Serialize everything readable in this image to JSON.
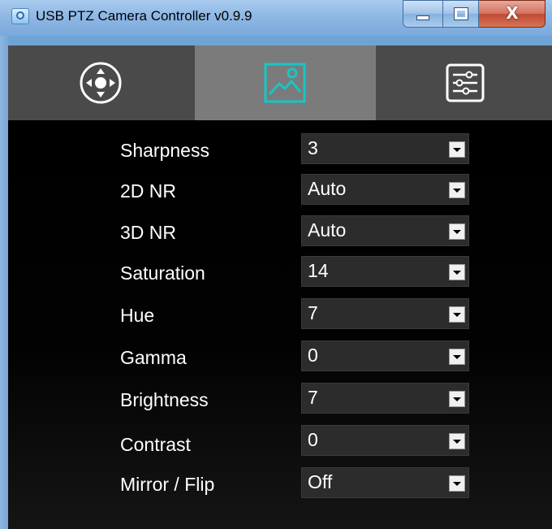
{
  "window": {
    "title": "USB PTZ Camera Controller v0.9.9",
    "icon": "camera-app-icon",
    "caption_buttons": [
      "minimize-icon",
      "maximize-icon",
      "close-icon"
    ],
    "close_glyph": "X"
  },
  "tabs": [
    {
      "name": "ptz-control",
      "icon": "directional-pad-icon",
      "active": false
    },
    {
      "name": "image-settings",
      "icon": "image-icon",
      "active": true
    },
    {
      "name": "advanced-settings",
      "icon": "sliders-icon",
      "active": false
    }
  ],
  "colors": {
    "accent": "#16c7c7",
    "active_tab": "#7b7b7b",
    "tabbar": "#4a4a4a",
    "panel": "#000000",
    "select_bg": "#2c2c2c"
  },
  "settings": [
    {
      "label": "Sharpness",
      "value": "3"
    },
    {
      "label": "2D NR",
      "value": "Auto"
    },
    {
      "label": "3D NR",
      "value": "Auto"
    },
    {
      "label": "Saturation",
      "value": "14"
    },
    {
      "label": "Hue",
      "value": "7"
    },
    {
      "label": "Gamma",
      "value": "0"
    },
    {
      "label": "Brightness",
      "value": "7"
    },
    {
      "label": "Contrast",
      "value": "0"
    },
    {
      "label": "Mirror / Flip",
      "value": "Off"
    }
  ]
}
